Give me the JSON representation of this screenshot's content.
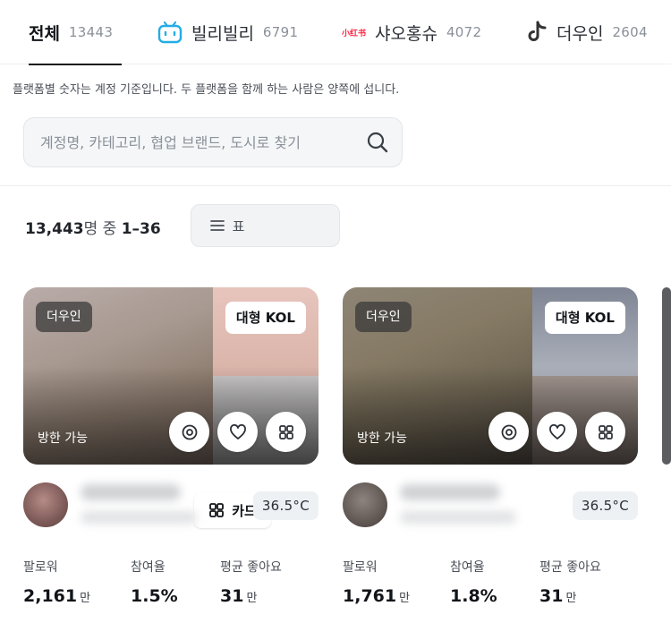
{
  "tabs": [
    {
      "label": "전체",
      "count": "13443",
      "icon": "all"
    },
    {
      "label": "빌리빌리",
      "count": "6791",
      "icon": "bilibili-icon"
    },
    {
      "label": "샤오홍슈",
      "count": "4072",
      "icon": "xiaohongshu-icon",
      "icon_text": "小红书"
    },
    {
      "label": "더우인",
      "count": "2604",
      "icon": "douyin-icon"
    }
  ],
  "notice": "플랫폼별 숫자는 계정 기준입니다. 두 플랫폼을 함께 하는 사람은 양쪽에 섭니다.",
  "search": {
    "placeholder": "계정명, 카테고리, 협업 브랜드, 도시로 찾기"
  },
  "result": {
    "total": "13,443",
    "unit": "명 중",
    "range": "1–36"
  },
  "view_toggle": {
    "table_label": "표",
    "card_label": "카드",
    "selected": "카드"
  },
  "colors": {
    "accent": "#111418",
    "bilibili": "#23ade5",
    "xiaohongshu": "#ff2442"
  },
  "cards": [
    {
      "platform": "더우인",
      "tier": "대형 KOL",
      "visit": "방한 가능",
      "temperature": "36.5°C",
      "stats": [
        {
          "label": "팔로워",
          "value": "2,161",
          "unit": "만"
        },
        {
          "label": "참여율",
          "value": "1.5%",
          "unit": ""
        },
        {
          "label": "평균 좋아요",
          "value": "31",
          "unit": "만"
        }
      ]
    },
    {
      "platform": "더우인",
      "tier": "대형 KOL",
      "visit": "방한 가능",
      "temperature": "36.5°C",
      "stats": [
        {
          "label": "팔로워",
          "value": "1,761",
          "unit": "만"
        },
        {
          "label": "참여율",
          "value": "1.8%",
          "unit": ""
        },
        {
          "label": "평균 좋아요",
          "value": "31",
          "unit": "만"
        }
      ]
    }
  ]
}
